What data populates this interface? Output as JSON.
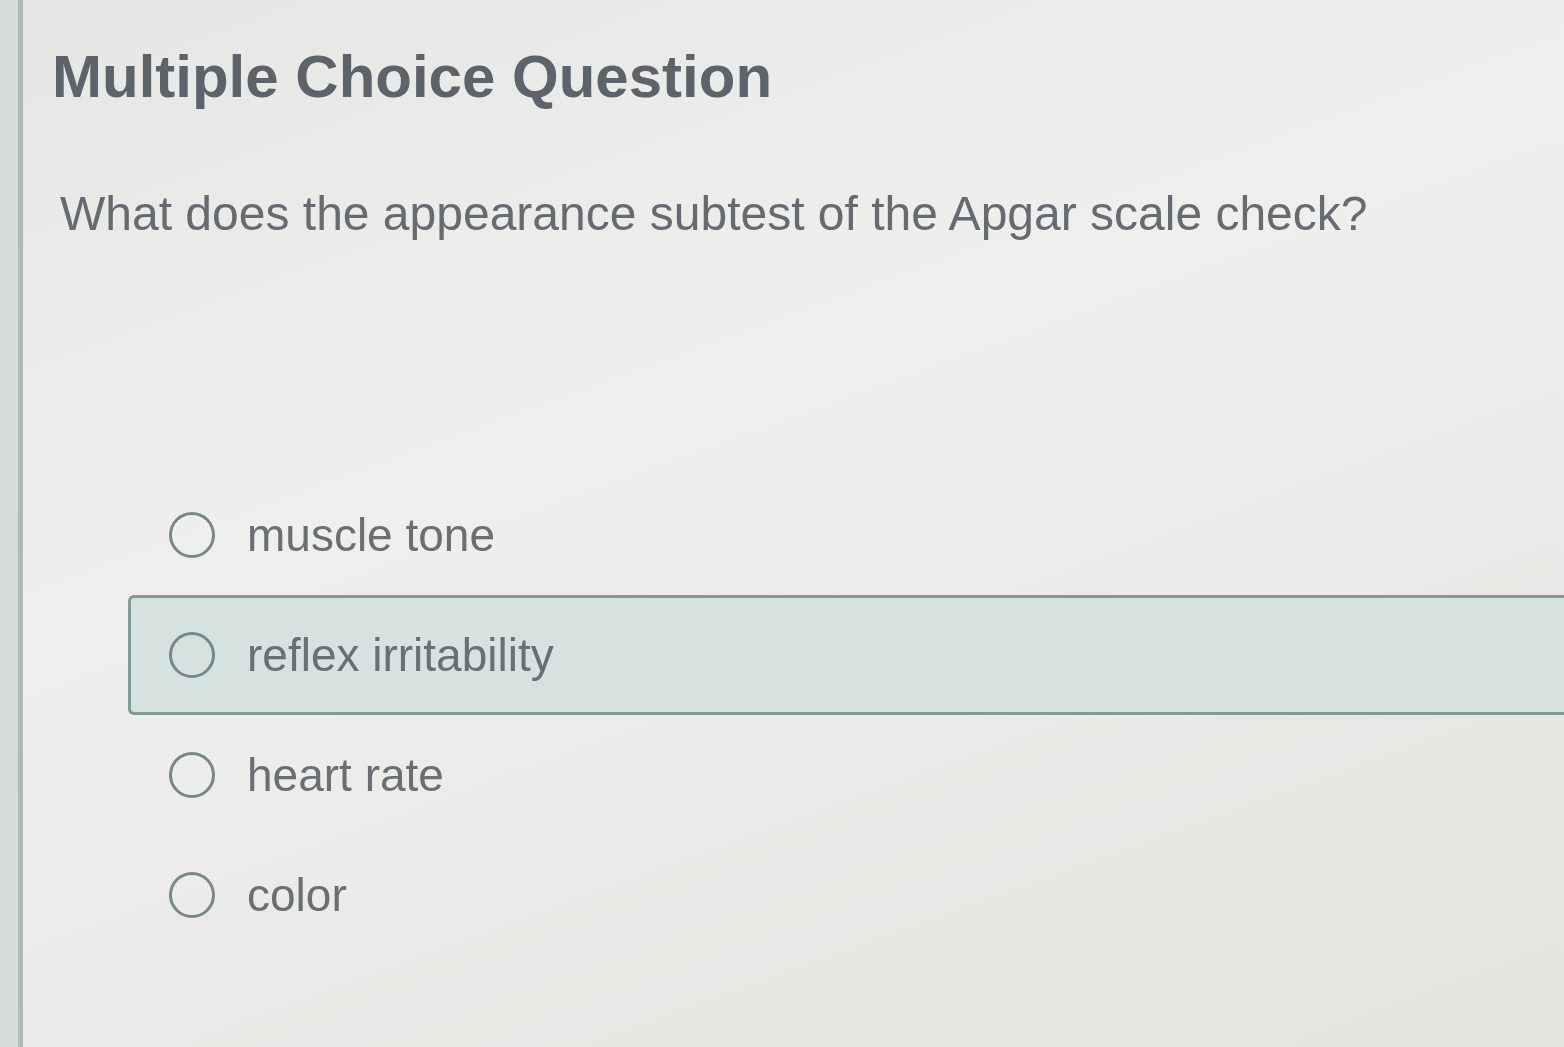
{
  "title": "Multiple Choice Question",
  "question": "What does the appearance subtest of the Apgar scale check?",
  "options": [
    {
      "label": "muscle tone",
      "selected": false,
      "highlighted": false
    },
    {
      "label": "reflex irritability",
      "selected": false,
      "highlighted": true
    },
    {
      "label": "heart rate",
      "selected": false,
      "highlighted": false
    },
    {
      "label": "color",
      "selected": false,
      "highlighted": false
    }
  ]
}
